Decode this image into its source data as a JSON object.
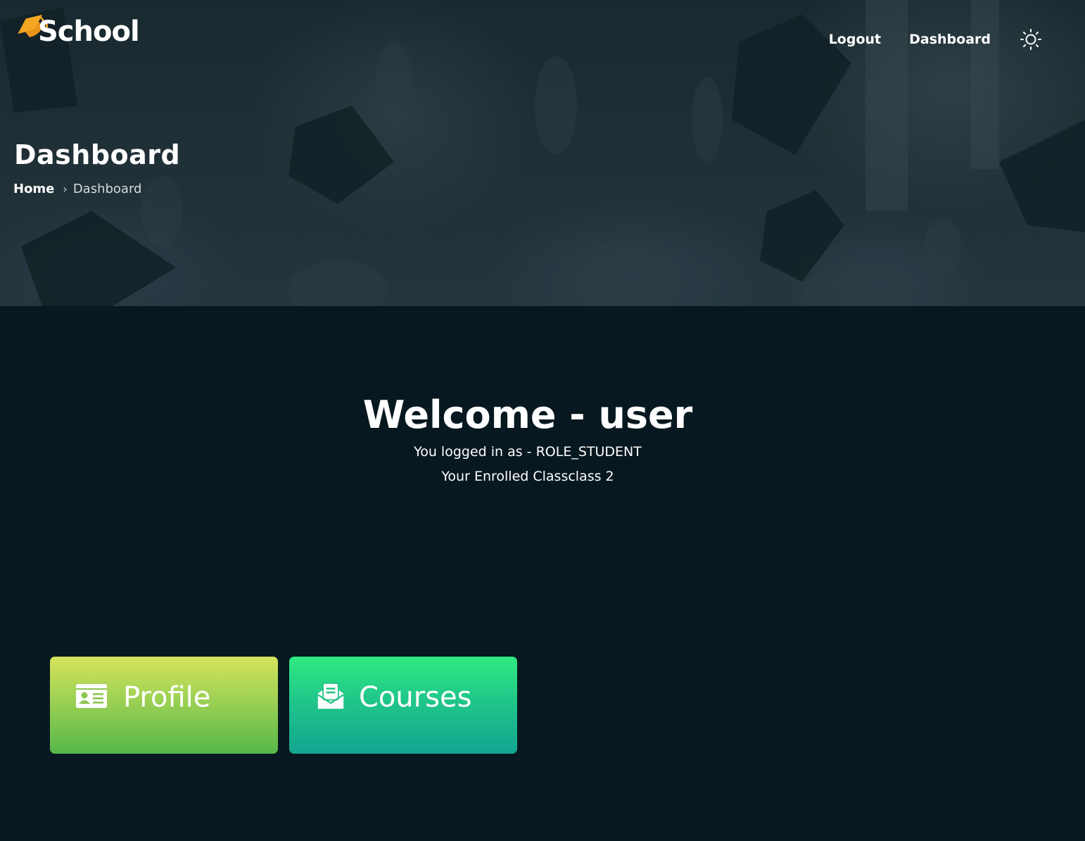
{
  "brand": {
    "name": "School",
    "icon": "graduation-cap-icon",
    "accent": "#f5a623"
  },
  "nav": {
    "logout": "Logout",
    "dashboard": "Dashboard",
    "theme_icon": "sun-icon"
  },
  "header": {
    "title": "Dashboard",
    "breadcrumb": {
      "home": "Home",
      "current": "Dashboard"
    }
  },
  "welcome": {
    "title": "Welcome - user",
    "role_line": "You logged in as - ROLE_STUDENT",
    "class_line": "Your Enrolled Classclass 2"
  },
  "cards": {
    "profile": {
      "label": "Profile",
      "icon": "id-card-icon"
    },
    "courses": {
      "label": "Courses",
      "icon": "envelope-open-icon"
    }
  },
  "colors": {
    "background": "#081820",
    "profile_gradient": [
      "#d6e35c",
      "#55b74a"
    ],
    "courses_gradient": [
      "#2feb80",
      "#13a591"
    ]
  }
}
